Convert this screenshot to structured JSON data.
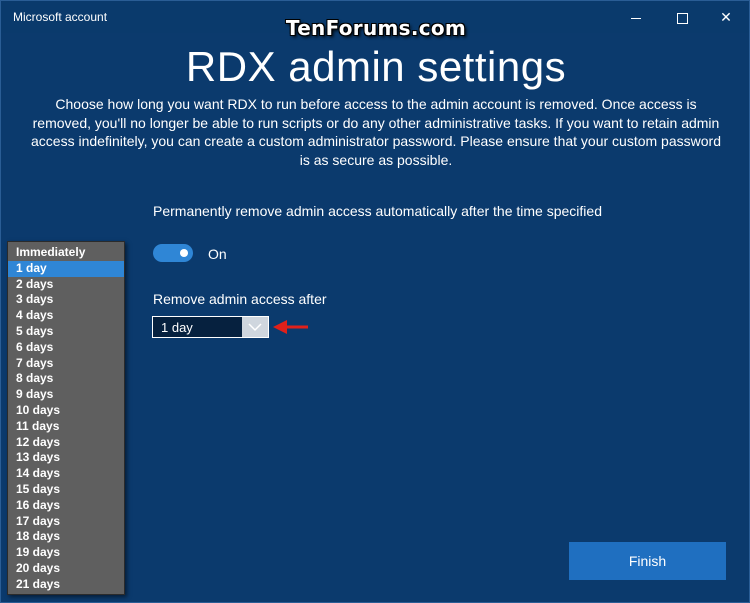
{
  "window": {
    "title": "Microsoft account",
    "watermark": "TenForums.com",
    "min_icon": "minimize-icon",
    "max_icon": "maximize-icon",
    "close_icon": "close-icon",
    "close_glyph": "✕"
  },
  "main": {
    "heading": "RDX admin settings",
    "description": "Choose how long you want RDX to run before access to the admin account is removed. Once access is removed, you'll no longer be able to run scripts or do any other administrative tasks. If you want to retain admin access indefinitely, you can create a custom administrator password. Please ensure that your custom password is as secure as possible.",
    "toggle": {
      "label": "Permanently remove admin access automatically after the time specified",
      "state_text": "On",
      "on": true
    },
    "remove_after": {
      "label": "Remove admin access after",
      "selected": "1 day"
    },
    "finish_label": "Finish"
  },
  "dropdown": {
    "selected_index": 1,
    "options": [
      "Immediately",
      "1 day",
      "2 days",
      "3 days",
      "4 days",
      "5 days",
      "6 days",
      "7 days",
      "8 days",
      "9 days",
      "10 days",
      "11 days",
      "12 days",
      "13 days",
      "14 days",
      "15 days",
      "16 days",
      "17 days",
      "18 days",
      "19 days",
      "20 days",
      "21 days"
    ]
  },
  "colors": {
    "background": "#0b3a6d",
    "accent": "#2f86d6",
    "annotation_arrow": "#e0201a"
  }
}
